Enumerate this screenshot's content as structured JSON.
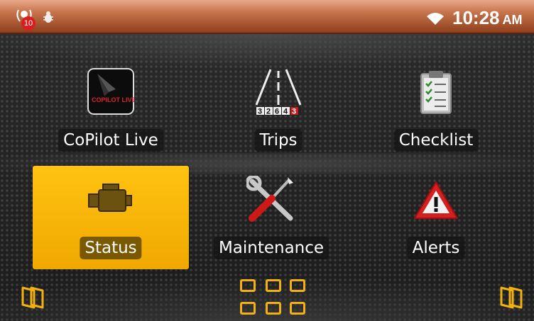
{
  "status_bar": {
    "notification_count": "10",
    "time": "10:28",
    "ampm": "AM",
    "icons": [
      "notification-icon",
      "bug-icon",
      "wifi-icon"
    ]
  },
  "tiles": [
    {
      "label": "CoPilot Live",
      "icon": "copilot-live-icon",
      "icon_text": "COPILOT LIVE"
    },
    {
      "label": "Trips",
      "icon": "road-icon",
      "odometer": [
        "3",
        "2",
        "6",
        "4",
        "3"
      ]
    },
    {
      "label": "Checklist",
      "icon": "clipboard-icon"
    },
    {
      "label": "Status",
      "icon": "engine-icon",
      "selected": true
    },
    {
      "label": "Maintenance",
      "icon": "tools-icon"
    },
    {
      "label": "Alerts",
      "icon": "warning-icon"
    }
  ],
  "bottom": {
    "icons": [
      "book-left-icon",
      "app-grid-icon",
      "book-right-icon"
    ]
  },
  "colors": {
    "accent": "#f5b400",
    "status_bar": "#b35a30"
  }
}
